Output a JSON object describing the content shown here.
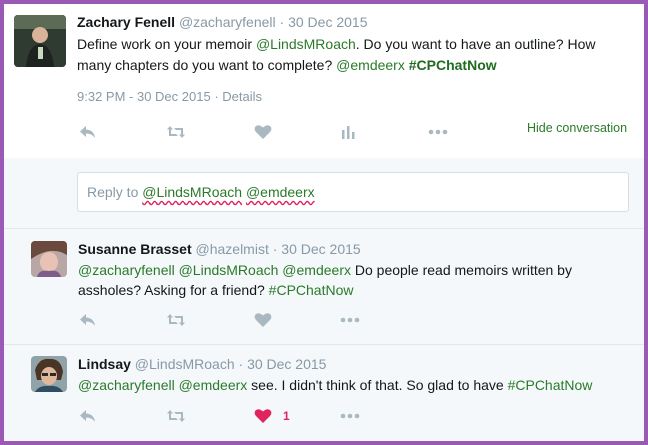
{
  "colors": {
    "frame_border": "#9b59b6",
    "link": "#2a7a2a",
    "muted": "#8899a6",
    "like_active": "#e0245e"
  },
  "main_tweet": {
    "name": "Zachary Fenell",
    "handle": "@zacharyfenell",
    "sep": "·",
    "date": "30 Dec 2015",
    "text_1": "Define work on your memoir ",
    "mention_1": "@LindsMRoach",
    "text_2": ". Do you want to have an outline? How many chapters do you want to complete? ",
    "mention_2": "@emdeerx",
    "hashtag": "#CPChatNow",
    "timestamp": "9:32 PM - 30 Dec 2015",
    "details_label": "Details",
    "hide_label": "Hide conversation",
    "icons": [
      "reply-icon",
      "retweet-icon",
      "heart-icon",
      "analytics-icon",
      "more-icon"
    ]
  },
  "reply_box": {
    "prefix": "Reply to ",
    "mention_1": "@LindsMRoach",
    "mention_2": "@emdeerx"
  },
  "replies": [
    {
      "name": "Susanne Brasset",
      "handle": "@hazelmist",
      "sep": "·",
      "date": "30 Dec 2015",
      "mention_1": "@zacharyfenell",
      "mention_2": "@LindsMRoach",
      "mention_3": "@emdeerx",
      "text": " Do people read memoirs written by assholes? Asking for a friend? ",
      "hashtag": "#CPChatNow"
    },
    {
      "name": "Lindsay",
      "handle": "@LindsMRoach",
      "sep": "·",
      "date": "30 Dec 2015",
      "mention_1": "@zacharyfenell",
      "mention_2": "@emdeerx",
      "text": " see. I didn't think of that. So glad to have ",
      "hashtag": "#CPChatNow",
      "like_count": "1"
    }
  ]
}
